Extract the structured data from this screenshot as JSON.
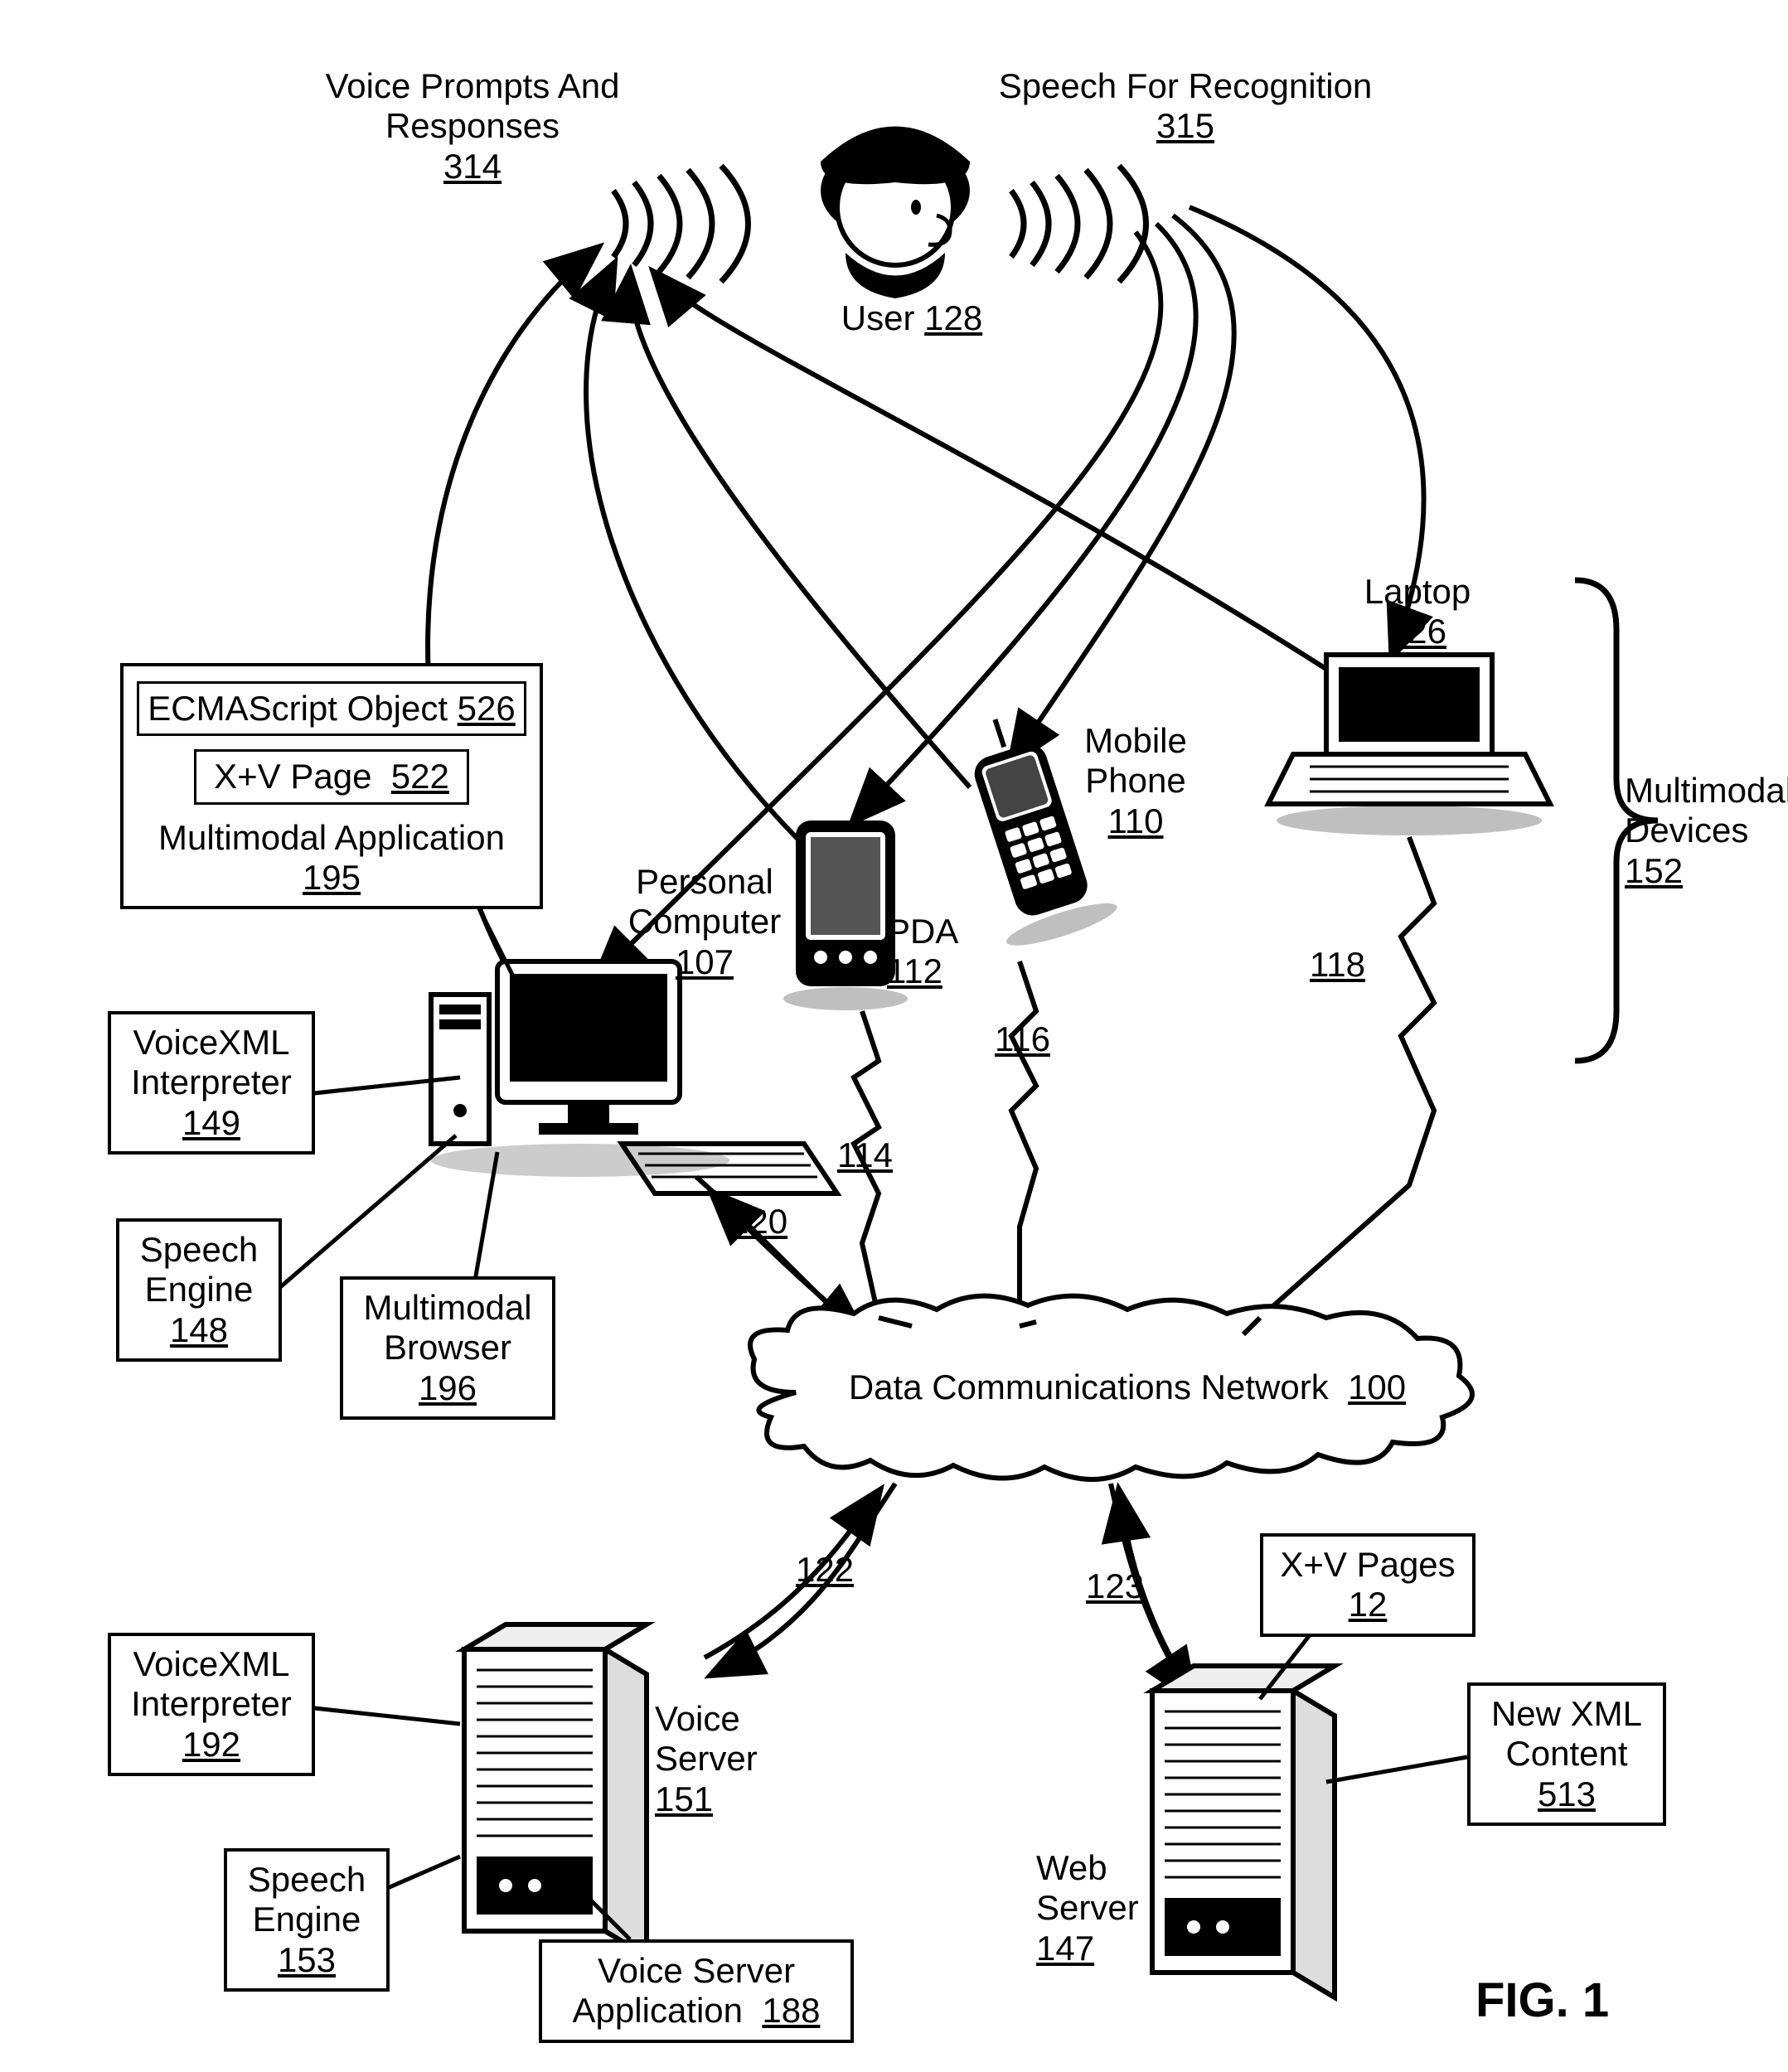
{
  "figure_label": "FIG. 1",
  "top": {
    "voice_prompts": {
      "text": "Voice Prompts And Responses",
      "num": "314"
    },
    "speech_rec": {
      "text": "Speech For Recognition",
      "num": "315"
    },
    "user": {
      "text": "User",
      "num": "128"
    }
  },
  "devices": {
    "laptop": {
      "text": "Laptop",
      "num": "126"
    },
    "mobile": {
      "text": "Mobile Phone",
      "num": "110"
    },
    "pda": {
      "text": "PDA",
      "num": "112"
    },
    "pc": {
      "text": "Personal Computer",
      "num": "107"
    },
    "group_label": {
      "text": "Multimodal Devices",
      "num": "152"
    }
  },
  "app_box": {
    "ecma": {
      "text": "ECMAScript Object",
      "num": "526"
    },
    "xvpage": {
      "text": "X+V Page",
      "num": "522"
    },
    "mmapp": {
      "text": "Multimodal Application",
      "num": "195"
    }
  },
  "pc_components": {
    "vxml_interp": {
      "text": "VoiceXML Interpreter",
      "num": "149"
    },
    "speech_engine": {
      "text": "Speech Engine",
      "num": "148"
    },
    "mm_browser": {
      "text": "Multimodal Browser",
      "num": "196"
    }
  },
  "links": {
    "pc_net": "120",
    "pda_net": "114",
    "mobile_net": "116",
    "laptop_net": "118",
    "voice_net": "122",
    "web_net": "123"
  },
  "cloud": {
    "text": "Data Communications Network",
    "num": "100"
  },
  "voice_server": {
    "label": {
      "text": "Voice Server",
      "num": "151"
    },
    "vxml_interp": {
      "text": "VoiceXML Interpreter",
      "num": "192"
    },
    "speech_engine": {
      "text": "Speech Engine",
      "num": "153"
    },
    "app": {
      "text": "Voice Server Application",
      "num": "188"
    }
  },
  "web_server": {
    "label": {
      "text": "Web Server",
      "num": "147"
    },
    "xvpages": {
      "text": "X+V Pages",
      "num": "12"
    },
    "newxml": {
      "text": "New XML Content",
      "num": "513"
    }
  }
}
